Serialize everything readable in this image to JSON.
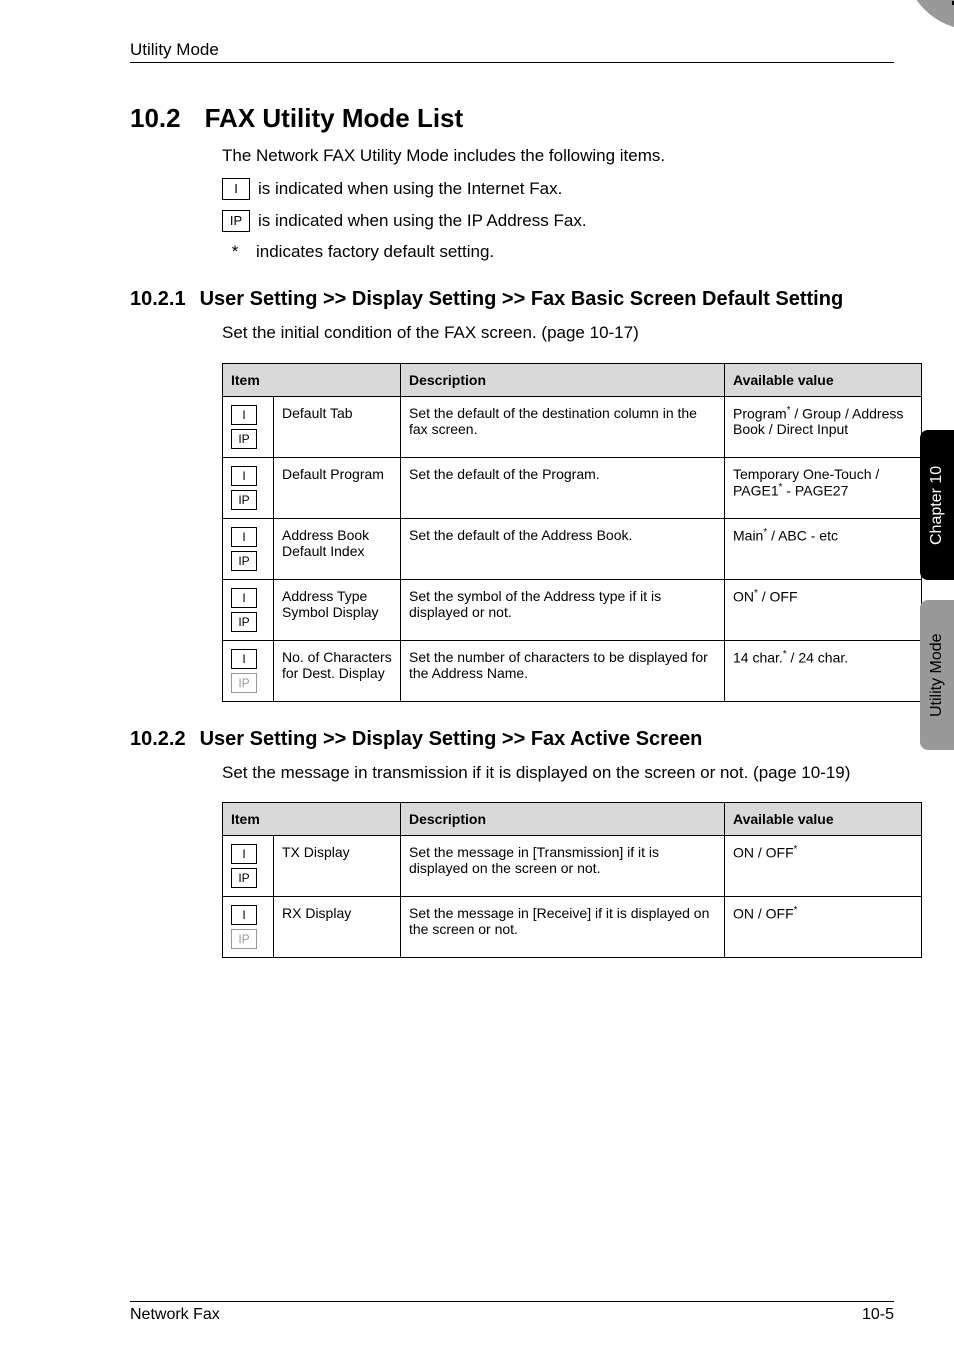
{
  "header": {
    "section_label": "Utility Mode",
    "chapter_number": "10"
  },
  "h2": {
    "number": "10.2",
    "title": "FAX Utility Mode List",
    "intro": "The Network FAX Utility Mode includes the following items."
  },
  "legend": {
    "i_text": "is indicated when using the Internet Fax.",
    "ip_text": "is indicated when using the IP Address Fax.",
    "star_marker": "*",
    "star_text": "indicates factory default setting."
  },
  "section1": {
    "number": "10.2.1",
    "title": "User Setting >> Display Setting >> Fax Basic Screen Default Setting",
    "lead": "Set the initial condition of the FAX screen. (page 10-17)",
    "table": {
      "headers": [
        "Item",
        "Description",
        "Available value"
      ],
      "rows": [
        {
          "item": "Default Tab",
          "desc": "Set the default of the destination column in the fax screen.",
          "value": "Program* / Group / Address Book / Direct Input"
        },
        {
          "item": "Default Program",
          "desc": "Set the default of the Program.",
          "value": "Temporary One-Touch / PAGE1* - PAGE27"
        },
        {
          "item": "Address Book Default Index",
          "desc": "Set the default of the Address Book.",
          "value": "Main* / ABC - etc"
        },
        {
          "item": "Address Type Symbol Display",
          "desc": "Set the symbol of the Address type if it is displayed or not.",
          "value": "ON* / OFF"
        },
        {
          "item": "No. of Characters for Dest. Display",
          "desc": "Set the number of characters to be displayed for the Address Name.",
          "value": "14 char.* / 24 char.",
          "ghost_ip": true
        }
      ]
    }
  },
  "section2": {
    "number": "10.2.2",
    "title": "User Setting >> Display Setting >> Fax Active Screen",
    "lead": "Set the message in transmission if it is displayed on the screen or not. (page 10-19)",
    "table": {
      "headers": [
        "Item",
        "Description",
        "Available value"
      ],
      "rows": [
        {
          "item": "TX Display",
          "desc": "Set the message in [Transmission] if it is displayed on the screen or not.",
          "value": "ON / OFF*"
        },
        {
          "item": "RX Display",
          "desc": "Set the message in [Receive] if it is displayed on the screen or not.",
          "value": "ON / OFF*",
          "ghost_ip": true
        }
      ]
    }
  },
  "icons": {
    "I": "I",
    "IP": "IP"
  },
  "sidetabs": {
    "dark": "Chapter 10",
    "gray": "Utility Mode"
  },
  "footer": {
    "left": "Network Fax",
    "right": "10-5"
  }
}
